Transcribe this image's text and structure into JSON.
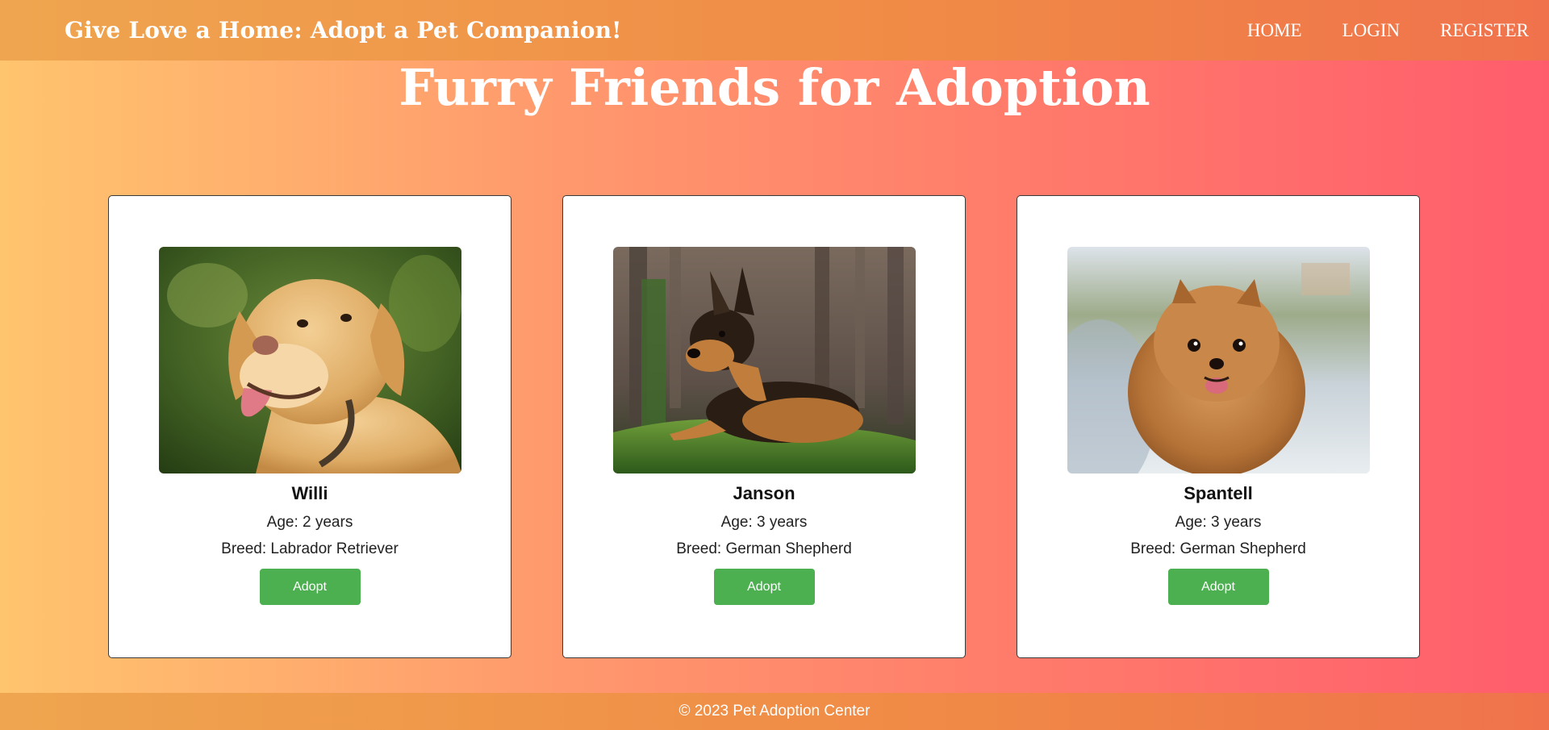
{
  "header": {
    "site_title": "Give Love a Home: Adopt a Pet Companion!",
    "nav": [
      {
        "label": "HOME"
      },
      {
        "label": "LOGIN"
      },
      {
        "label": "REGISTER"
      }
    ]
  },
  "main": {
    "title": "Furry Friends for Adoption",
    "pets": [
      {
        "name": "Willi",
        "age": "Age: 2 years",
        "breed": "Breed: Labrador Retriever",
        "button": "Adopt",
        "photo_icon": "labrador-photo"
      },
      {
        "name": "Janson",
        "age": "Age: 3 years",
        "breed": "Breed: German Shepherd",
        "button": "Adopt",
        "photo_icon": "german-shepherd-photo"
      },
      {
        "name": "Spantell",
        "age": "Age: 3 years",
        "breed": "Breed: German Shepherd",
        "button": "Adopt",
        "photo_icon": "pomeranian-photo"
      }
    ]
  },
  "footer": {
    "text": "© 2023 Pet Adoption Center"
  },
  "colors": {
    "accent_button": "#4caf50",
    "header_bg": "#f08a46",
    "gradient_left": "#ffc46e",
    "gradient_right": "#ff5d6c"
  }
}
